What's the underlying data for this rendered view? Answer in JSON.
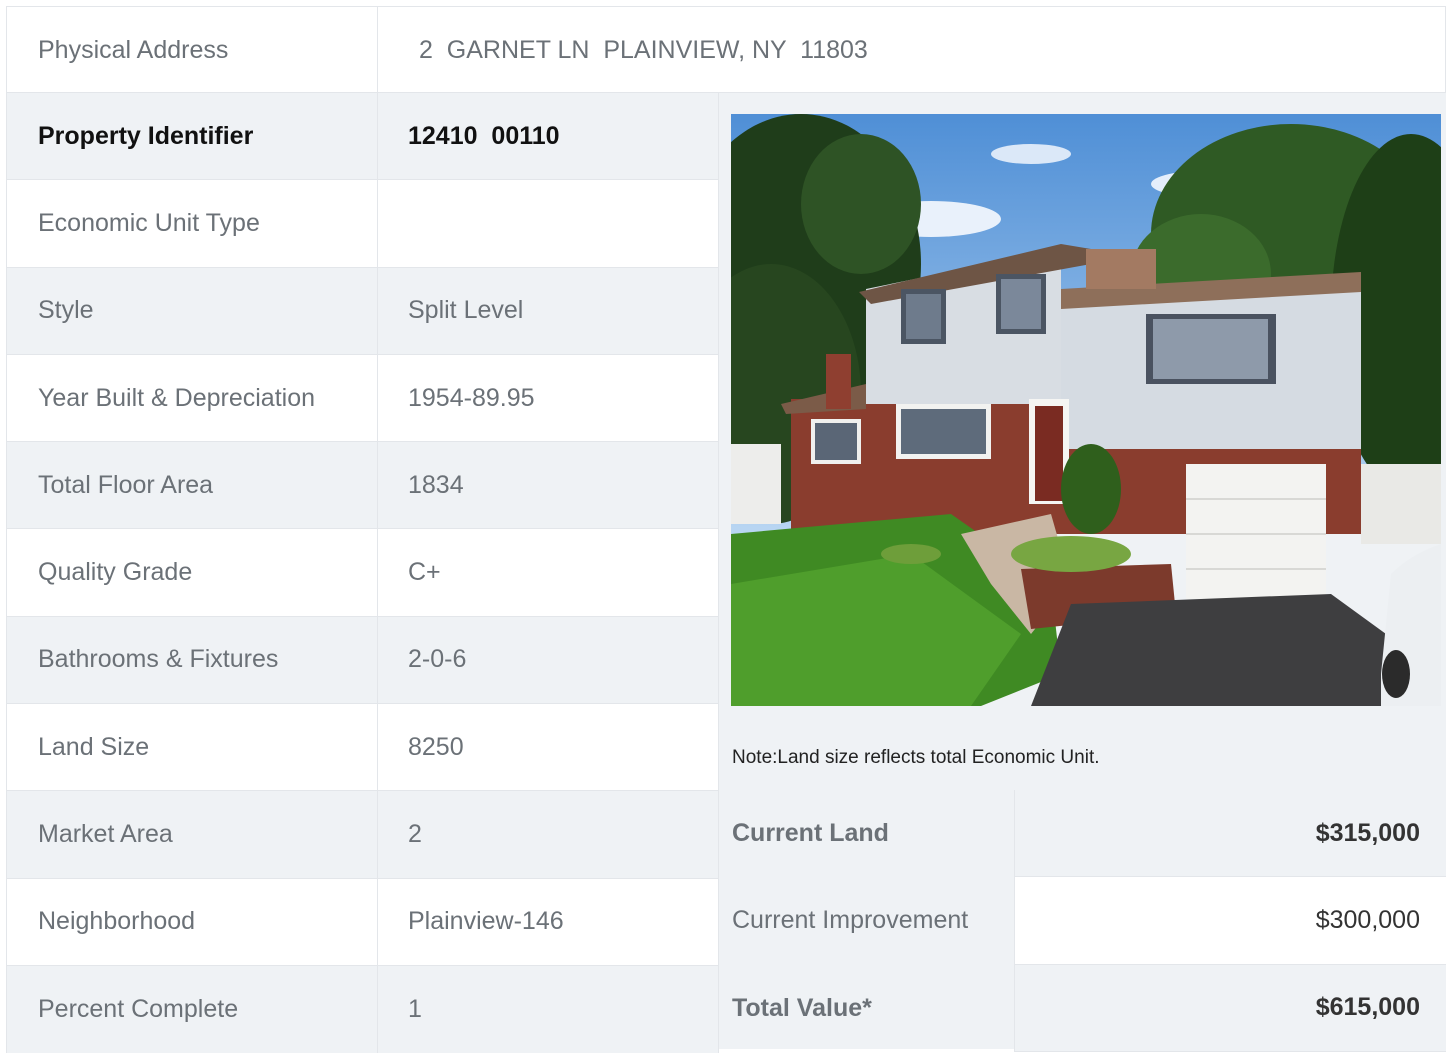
{
  "address": {
    "label": "Physical Address",
    "value": "2  GARNET LN  PLAINVIEW, NY  11803"
  },
  "property": {
    "rows": [
      {
        "label": "Property Identifier",
        "value": "12410  00110"
      },
      {
        "label": "Economic Unit Type",
        "value": ""
      },
      {
        "label": "Style",
        "value": "Split Level"
      },
      {
        "label": "Year Built & Depreciation",
        "value": "1954-89.95"
      },
      {
        "label": "Total Floor Area",
        "value": "1834"
      },
      {
        "label": "Quality Grade",
        "value": "C+"
      },
      {
        "label": "Bathrooms & Fixtures",
        "value": "2-0-6"
      },
      {
        "label": "Land Size",
        "value": "8250"
      },
      {
        "label": "Market Area",
        "value": "2"
      },
      {
        "label": "Neighborhood",
        "value": "Plainview-146"
      },
      {
        "label": "Percent Complete",
        "value": "1"
      }
    ]
  },
  "photo": {
    "icon": "house-photo"
  },
  "note": "Note:Land size reflects total Economic Unit.",
  "valuation": {
    "rows": [
      {
        "label": "Current Land",
        "value": "$315,000"
      },
      {
        "label": "Current Improvement",
        "value": "$300,000"
      },
      {
        "label": "Total Value*",
        "value": "$615,000"
      }
    ]
  }
}
